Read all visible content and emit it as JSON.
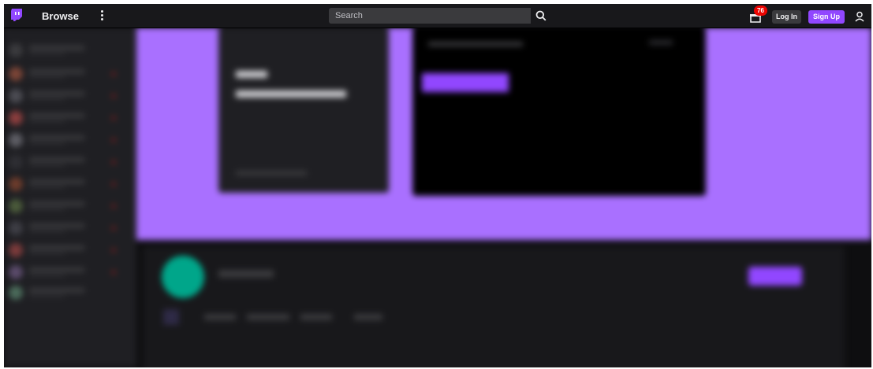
{
  "nav": {
    "browse_label": "Browse",
    "search_placeholder": "Search",
    "notification_count": "76",
    "login_label": "Log In",
    "signup_label": "Sign Up"
  },
  "icons": {
    "logo": "twitch-glitch-icon",
    "more": "vertical-dots-icon",
    "search": "search-icon",
    "prime": "crown-gift-icon",
    "user": "user-icon"
  },
  "colors": {
    "brand": "#9147ff",
    "hero_bg": "#a970ff",
    "badge": "#eb0400",
    "avatar_accent": "#00a68a",
    "nav_bg": "#18181b",
    "page_bg": "#0e0e10"
  }
}
